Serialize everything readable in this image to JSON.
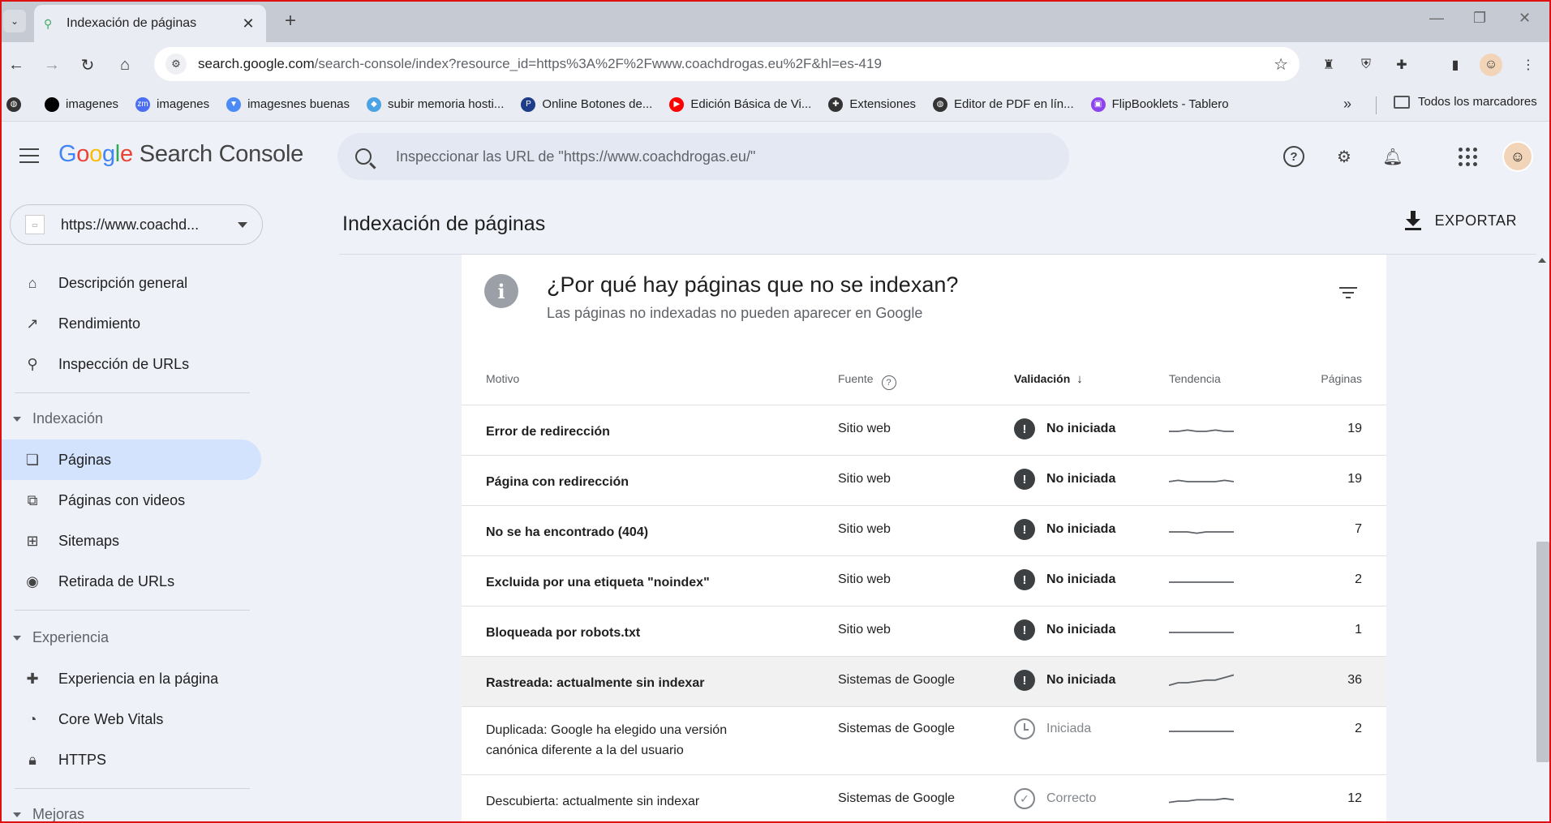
{
  "browser": {
    "tab_title": "Indexación de páginas",
    "url_host": "search.google.com",
    "url_path": "/search-console/index?resource_id=https%3A%2F%2Fwww.coachdrogas.eu%2F&hl=es-419",
    "bookmarks": [
      {
        "label": "imagenes",
        "color": "#000000"
      },
      {
        "label": "imagenes",
        "color": "#4c6ef5"
      },
      {
        "label": "imagesnes buenas",
        "color": "#4c8bf5"
      },
      {
        "label": "subir memoria hosti...",
        "color": "#4ba3e3"
      },
      {
        "label": "Online Botones de...",
        "color": "#1f3c88"
      },
      {
        "label": "Edición Básica de Vi...",
        "color": "#ff0000"
      },
      {
        "label": "Extensiones",
        "color": "#333333"
      },
      {
        "label": "Editor de PDF en lín...",
        "color": "#333333"
      },
      {
        "label": "FlipBooklets - Tablero",
        "color": "#8e44ec"
      }
    ],
    "all_bookmarks": "Todos los marcadores"
  },
  "header": {
    "product": "Search Console",
    "search_placeholder": "Inspeccionar las URL de \"https://www.coachdrogas.eu/\""
  },
  "sidebar": {
    "property": "https://www.coachd...",
    "items_top": [
      {
        "label": "Descripción general",
        "icon": "home-icon"
      },
      {
        "label": "Rendimiento",
        "icon": "trending-icon"
      },
      {
        "label": "Inspección de URLs",
        "icon": "search-icon"
      }
    ],
    "section_indexacion": "Indexación",
    "items_indexacion": [
      {
        "label": "Páginas",
        "icon": "pages-icon"
      },
      {
        "label": "Páginas con videos",
        "icon": "video-pages-icon"
      },
      {
        "label": "Sitemaps",
        "icon": "sitemap-icon"
      },
      {
        "label": "Retirada de URLs",
        "icon": "removal-icon"
      }
    ],
    "section_experiencia": "Experiencia",
    "items_experiencia": [
      {
        "label": "Experiencia en la página",
        "icon": "page-experience-icon"
      },
      {
        "label": "Core Web Vitals",
        "icon": "gauge-icon"
      },
      {
        "label": "HTTPS",
        "icon": "lock-icon"
      }
    ],
    "section_mejoras": "Mejoras"
  },
  "main": {
    "page_title": "Indexación de páginas",
    "export_label": "EXPORTAR",
    "card_title": "¿Por qué hay páginas que no se indexan?",
    "card_subtitle": "Las páginas no indexadas no pueden aparecer en Google",
    "columns": {
      "motivo": "Motivo",
      "fuente": "Fuente",
      "validacion": "Validación",
      "tendencia": "Tendencia",
      "paginas": "Páginas"
    },
    "rows": [
      {
        "motivo": "Error de redirección",
        "fuente": "Sitio web",
        "validacion": "No iniciada",
        "status": "warn",
        "paginas": "19",
        "trend": [
          5,
          5,
          6,
          5,
          5,
          6,
          5,
          5
        ]
      },
      {
        "motivo": "Página con redirección",
        "fuente": "Sitio web",
        "validacion": "No iniciada",
        "status": "warn",
        "paginas": "19",
        "trend": [
          5,
          6,
          5,
          5,
          5,
          5,
          6,
          5
        ]
      },
      {
        "motivo": "No se ha encontrado (404)",
        "fuente": "Sitio web",
        "validacion": "No iniciada",
        "status": "warn",
        "paginas": "7",
        "trend": [
          5,
          5,
          5,
          4,
          5,
          5,
          5,
          5
        ]
      },
      {
        "motivo": "Excluida por una etiqueta \"noindex\"",
        "fuente": "Sitio web",
        "validacion": "No iniciada",
        "status": "warn",
        "paginas": "2",
        "trend": [
          5,
          5,
          5,
          5,
          5,
          5,
          5,
          5
        ]
      },
      {
        "motivo": "Bloqueada por robots.txt",
        "fuente": "Sitio web",
        "validacion": "No iniciada",
        "status": "warn",
        "paginas": "1",
        "trend": [
          5,
          5,
          5,
          5,
          5,
          5,
          5,
          5
        ]
      },
      {
        "motivo": "Rastreada: actualmente sin indexar",
        "fuente": "Sistemas de Google",
        "validacion": "No iniciada",
        "status": "warn",
        "paginas": "36",
        "trend": [
          3,
          5,
          5,
          6,
          7,
          7,
          9,
          11
        ]
      },
      {
        "motivo": "Duplicada: Google ha elegido una versión canónica diferente a la del usuario",
        "fuente": "Sistemas de Google",
        "validacion": "Iniciada",
        "status": "clock",
        "paginas": "2",
        "trend": [
          5,
          5,
          5,
          5,
          5,
          5,
          5,
          5
        ]
      },
      {
        "motivo": "Descubierta: actualmente sin indexar",
        "fuente": "Sistemas de Google",
        "validacion": "Correcto",
        "status": "check",
        "paginas": "12",
        "trend": [
          4,
          5,
          5,
          6,
          6,
          6,
          7,
          6
        ]
      }
    ]
  }
}
